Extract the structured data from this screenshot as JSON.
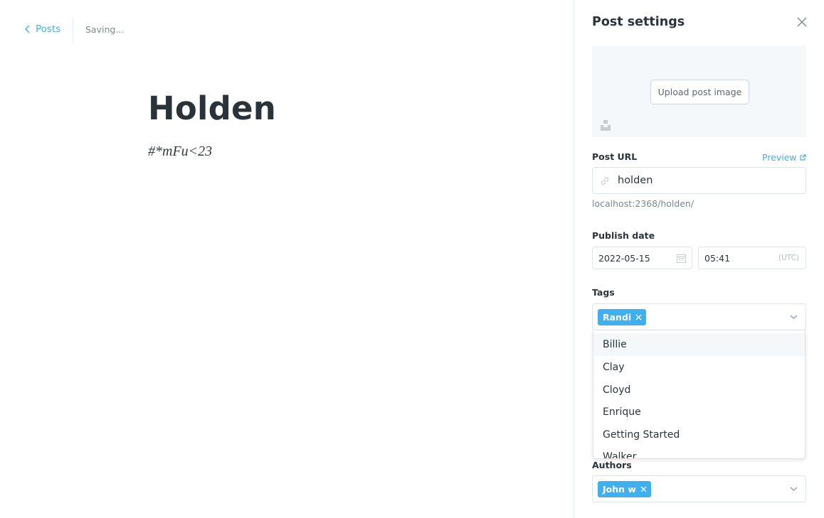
{
  "editor": {
    "back_label": "Posts",
    "status": "Saving...",
    "title": "Holden",
    "body": "#*mFu<23"
  },
  "settings": {
    "title": "Post settings",
    "upload_label": "Upload post image",
    "post_url_label": "Post URL",
    "preview_label": "Preview",
    "slug": "holden",
    "url_hint": "localhost:2368/holden/",
    "publish_date_label": "Publish date",
    "date": "2022-05-15",
    "time": "05:41",
    "timezone": "(UTC)",
    "tags_label": "Tags",
    "selected_tags": [
      "Randi"
    ],
    "tag_options": [
      "Billie",
      "Clay",
      "Cloyd",
      "Enrique",
      "Getting Started",
      "Walker"
    ],
    "authors_label": "Authors",
    "selected_authors": [
      "John w"
    ]
  },
  "colors": {
    "accent": "#3eb0ef",
    "text": "#2b343a",
    "muted": "#7d878a",
    "border": "#dde3e7"
  }
}
